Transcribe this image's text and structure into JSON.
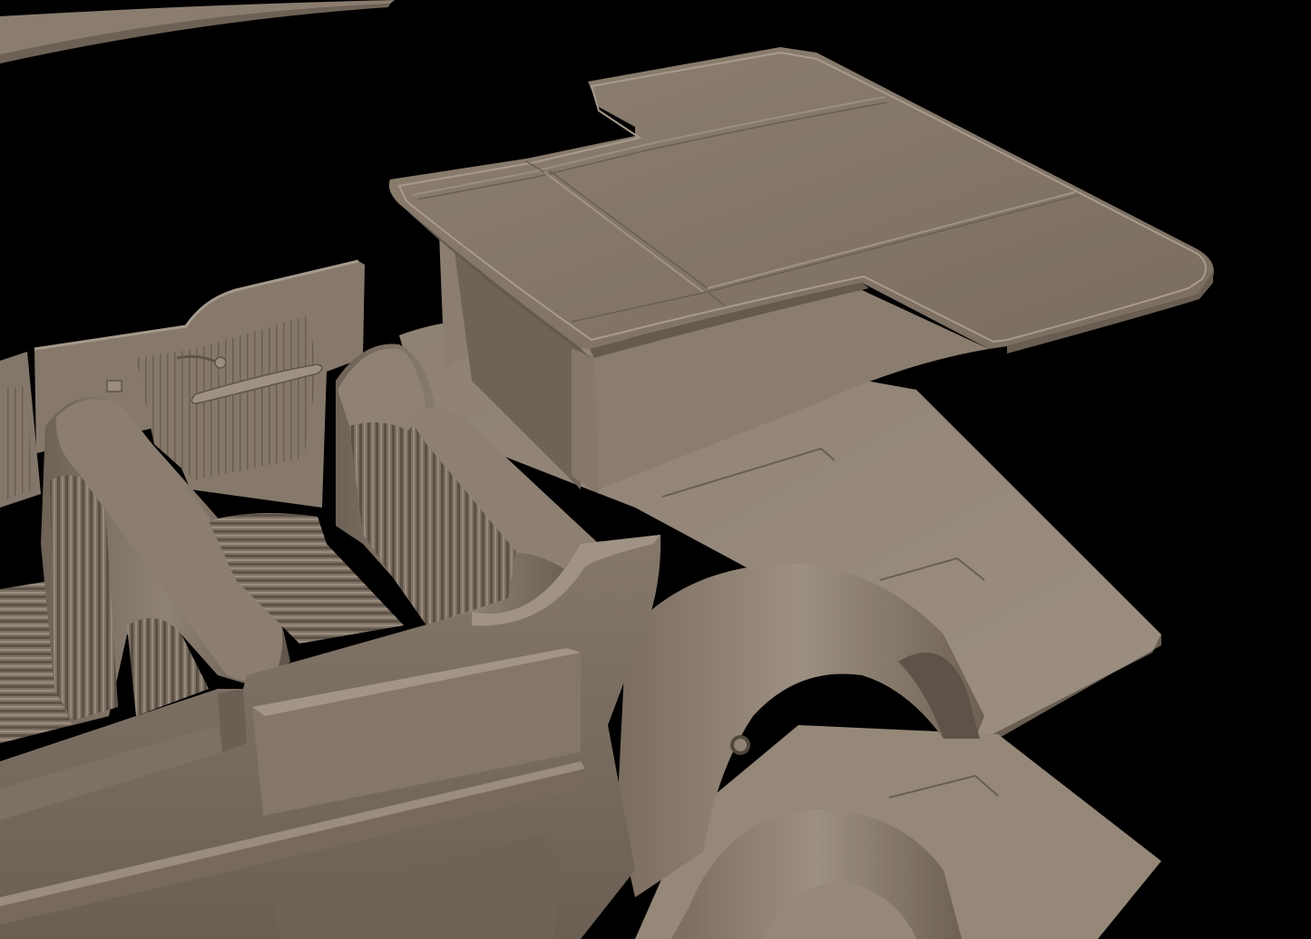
{
  "scene": {
    "background_color": "#000000",
    "model_color": "#8a7d70",
    "model_shadow_color": "#5e544a",
    "model_highlight_color": "#a79a8c",
    "parts": [
      "rear-deck-bar",
      "package-tray",
      "tray-support-column",
      "floor-pan",
      "rear-wheel-tub",
      "lower-floor-pan",
      "lower-wheel-tub",
      "door-panel",
      "rear-seat-left",
      "rear-seat-right",
      "side-panel"
    ]
  }
}
